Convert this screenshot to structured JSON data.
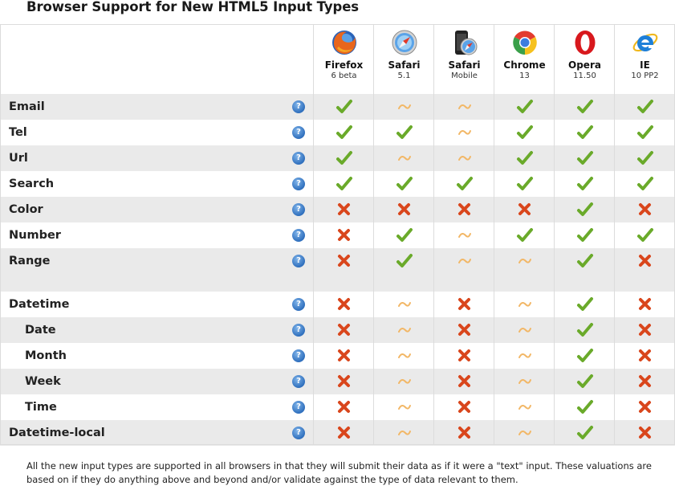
{
  "title": "Browser Support for New HTML5 Input Types",
  "browsers": [
    {
      "name": "Firefox",
      "version": "6 beta",
      "icon": "firefox-icon"
    },
    {
      "name": "Safari",
      "version": "5.1",
      "icon": "safari-icon"
    },
    {
      "name": "Safari",
      "version": "Mobile",
      "icon": "safari-mobile-icon"
    },
    {
      "name": "Chrome",
      "version": "13",
      "icon": "chrome-icon"
    },
    {
      "name": "Opera",
      "version": "11.50",
      "icon": "opera-icon"
    },
    {
      "name": "IE",
      "version": "10 PP2",
      "icon": "ie-icon"
    }
  ],
  "status_legend": {
    "Y": "check-icon",
    "P": "tilde-icon",
    "N": "cross-icon"
  },
  "status_colors": {
    "Y": "#6aaa2a",
    "P": "#f2b766",
    "N": "#d9461c"
  },
  "help_glyph": "?",
  "rows": [
    {
      "label": "Email",
      "indent": false,
      "support": [
        "Y",
        "P",
        "P",
        "Y",
        "Y",
        "Y"
      ]
    },
    {
      "label": "Tel",
      "indent": false,
      "support": [
        "Y",
        "Y",
        "P",
        "Y",
        "Y",
        "Y"
      ]
    },
    {
      "label": "Url",
      "indent": false,
      "support": [
        "Y",
        "P",
        "P",
        "Y",
        "Y",
        "Y"
      ]
    },
    {
      "label": "Search",
      "indent": false,
      "support": [
        "Y",
        "Y",
        "Y",
        "Y",
        "Y",
        "Y"
      ]
    },
    {
      "label": "Color",
      "indent": false,
      "support": [
        "N",
        "N",
        "N",
        "N",
        "Y",
        "N"
      ]
    },
    {
      "label": "Number",
      "indent": false,
      "support": [
        "N",
        "Y",
        "P",
        "Y",
        "Y",
        "Y"
      ]
    },
    {
      "label": "Range",
      "indent": false,
      "support": [
        "N",
        "Y",
        "P",
        "P",
        "Y",
        "N"
      ]
    },
    {
      "label": "Datetime",
      "indent": false,
      "support": [
        "N",
        "P",
        "N",
        "P",
        "Y",
        "N"
      ]
    },
    {
      "label": "Date",
      "indent": true,
      "support": [
        "N",
        "P",
        "N",
        "P",
        "Y",
        "N"
      ]
    },
    {
      "label": "Month",
      "indent": true,
      "support": [
        "N",
        "P",
        "N",
        "P",
        "Y",
        "N"
      ]
    },
    {
      "label": "Week",
      "indent": true,
      "support": [
        "N",
        "P",
        "N",
        "P",
        "Y",
        "N"
      ]
    },
    {
      "label": "Time",
      "indent": true,
      "support": [
        "N",
        "P",
        "N",
        "P",
        "Y",
        "N"
      ]
    },
    {
      "label": "Datetime-local",
      "indent": false,
      "support": [
        "N",
        "P",
        "N",
        "P",
        "Y",
        "N"
      ]
    }
  ],
  "footnote": "All the new input types are supported in all browsers in that they will submit their data as if it were a \"text\" input. These valuations are based on if they do anything above and beyond and/or validate against the type of data relevant to them."
}
